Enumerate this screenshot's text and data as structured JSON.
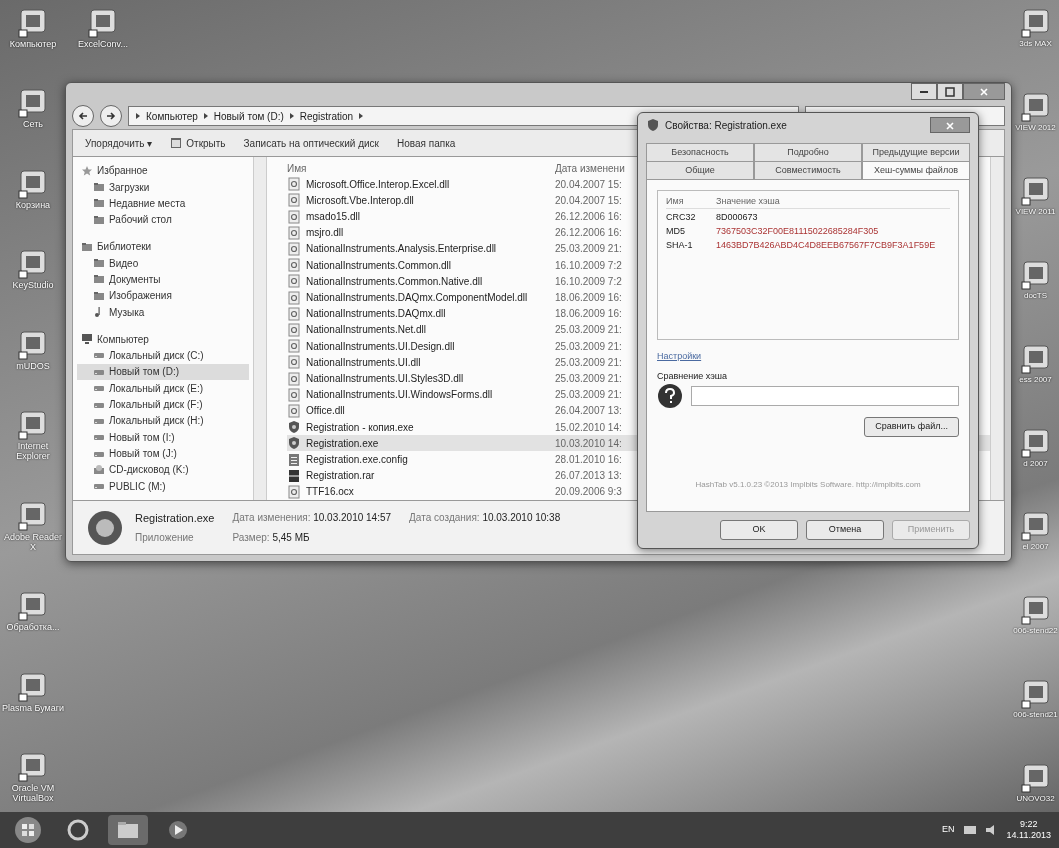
{
  "desktop_left": [
    {
      "label": "Компьютер"
    },
    {
      "label": "Сеть"
    },
    {
      "label": "Корзина"
    },
    {
      "label": "KeyStudio"
    },
    {
      "label": "mUDOS"
    },
    {
      "label": "Internet Explorer"
    },
    {
      "label": "Adobe Reader X"
    },
    {
      "label": "Обработка..."
    },
    {
      "label": "Plasma Бумаги"
    },
    {
      "label": "Oracle VM VirtualBox"
    }
  ],
  "desktop_top": [
    {
      "label": "ExcelConv..."
    }
  ],
  "desktop_right": [
    {
      "label": "3ds MAX"
    },
    {
      "label": "VIEW 2012"
    },
    {
      "label": "VIEW 2011"
    },
    {
      "label": "docTS"
    },
    {
      "label": "ess 2007"
    },
    {
      "label": "d 2007"
    },
    {
      "label": "el 2007"
    },
    {
      "label": "006-stend22"
    },
    {
      "label": "006-stend21"
    },
    {
      "label": "UNOVO32"
    }
  ],
  "explorer": {
    "breadcrumb": [
      "Компьютер",
      "Новый том (D:)",
      "Registration"
    ],
    "toolbar": [
      {
        "label": "Упорядочить ▾",
        "kind": "menu"
      },
      {
        "label": "Открыть",
        "kind": "open"
      },
      {
        "label": "Записать на оптический диск",
        "kind": "plain"
      },
      {
        "label": "Новая папка",
        "kind": "plain"
      }
    ],
    "nav": [
      {
        "label": "Избранное",
        "kind": "star",
        "children": [
          {
            "label": "Загрузки",
            "kind": "folder",
            "selected": false
          },
          {
            "label": "Недавние места",
            "kind": "folder",
            "selected": false
          },
          {
            "label": "Рабочий стол",
            "kind": "folder",
            "selected": false
          }
        ]
      },
      {
        "label": "Библиотеки",
        "kind": "folder",
        "children": [
          {
            "label": "Видео",
            "kind": "folder",
            "selected": false
          },
          {
            "label": "Документы",
            "kind": "folder",
            "selected": false
          },
          {
            "label": "Изображения",
            "kind": "folder",
            "selected": false
          },
          {
            "label": "Музыка",
            "kind": "music",
            "selected": false
          }
        ]
      },
      {
        "label": "Компьютер",
        "kind": "computer",
        "children": [
          {
            "label": "Локальный диск (C:)",
            "kind": "drive",
            "selected": false
          },
          {
            "label": "Новый том (D:)",
            "kind": "drive",
            "selected": true
          },
          {
            "label": "Локальный диск (E:)",
            "kind": "drive",
            "selected": false
          },
          {
            "label": "Локальный диск (F:)",
            "kind": "drive",
            "selected": false
          },
          {
            "label": "Локальный диск (H:)",
            "kind": "drive",
            "selected": false
          },
          {
            "label": "Новый том (I:)",
            "kind": "drive",
            "selected": false
          },
          {
            "label": "Новый том (J:)",
            "kind": "drive",
            "selected": false
          },
          {
            "label": "CD-дисковод (K:)",
            "kind": "cd",
            "selected": false
          },
          {
            "label": "PUBLIC (M:)",
            "kind": "drive",
            "selected": false
          }
        ]
      }
    ],
    "columns": [
      "Имя",
      "Дата изменени"
    ],
    "files": [
      {
        "name": "Microsoft.Office.Interop.Excel.dll",
        "date": "20.04.2007 15:",
        "kind": "dll",
        "selected": false
      },
      {
        "name": "Microsoft.Vbe.Interop.dll",
        "date": "20.04.2007 15:",
        "kind": "dll",
        "selected": false
      },
      {
        "name": "msado15.dll",
        "date": "26.12.2006 16:",
        "kind": "dll",
        "selected": false
      },
      {
        "name": "msjro.dll",
        "date": "26.12.2006 16:",
        "kind": "dll",
        "selected": false
      },
      {
        "name": "NationalInstruments.Analysis.Enterprise.dll",
        "date": "25.03.2009 21:",
        "kind": "dll",
        "selected": false
      },
      {
        "name": "NationalInstruments.Common.dll",
        "date": "16.10.2009 7:2",
        "kind": "dll",
        "selected": false
      },
      {
        "name": "NationalInstruments.Common.Native.dll",
        "date": "16.10.2009 7:2",
        "kind": "dll",
        "selected": false
      },
      {
        "name": "NationalInstruments.DAQmx.ComponentModel.dll",
        "date": "18.06.2009 16:",
        "kind": "dll",
        "selected": false
      },
      {
        "name": "NationalInstruments.DAQmx.dll",
        "date": "18.06.2009 16:",
        "kind": "dll",
        "selected": false
      },
      {
        "name": "NationalInstruments.Net.dll",
        "date": "25.03.2009 21:",
        "kind": "dll",
        "selected": false
      },
      {
        "name": "NationalInstruments.UI.Design.dll",
        "date": "25.03.2009 21:",
        "kind": "dll",
        "selected": false
      },
      {
        "name": "NationalInstruments.UI.dll",
        "date": "25.03.2009 21:",
        "kind": "dll",
        "selected": false
      },
      {
        "name": "NationalInstruments.UI.Styles3D.dll",
        "date": "25.03.2009 21:",
        "kind": "dll",
        "selected": false
      },
      {
        "name": "NationalInstruments.UI.WindowsForms.dll",
        "date": "25.03.2009 21:",
        "kind": "dll",
        "selected": false
      },
      {
        "name": "Office.dll",
        "date": "26.04.2007 13:",
        "kind": "dll",
        "selected": false
      },
      {
        "name": "Registration - копия.exe",
        "date": "15.02.2010 14:",
        "kind": "exe",
        "selected": false
      },
      {
        "name": "Registration.exe",
        "date": "10.03.2010 14:",
        "kind": "exe",
        "selected": true
      },
      {
        "name": "Registration.exe.config",
        "date": "28.01.2010 16:",
        "kind": "config",
        "selected": false
      },
      {
        "name": "Registration.rar",
        "date": "26.07.2013 13:",
        "kind": "rar",
        "selected": false
      },
      {
        "name": "TTF16.ocx",
        "date": "20.09.2006 9:3",
        "kind": "dll",
        "selected": false
      }
    ],
    "details": {
      "name": "Registration.exe",
      "type": "Приложение",
      "modified_label": "Дата изменения:",
      "modified": "10.03.2010 14:57",
      "size_label": "Размер:",
      "size": "5,45 МБ",
      "created_label": "Дата создания:",
      "created": "10.03.2010 10:38"
    }
  },
  "dialog": {
    "title": "Свойства: Registration.exe",
    "tab_rows": [
      [
        {
          "label": "Безопасность",
          "selected": false
        },
        {
          "label": "Подробно",
          "selected": false
        },
        {
          "label": "Предыдущие версии",
          "selected": false
        }
      ],
      [
        {
          "label": "Общие",
          "selected": false
        },
        {
          "label": "Совместимость",
          "selected": false
        },
        {
          "label": "Хеш-суммы файлов",
          "selected": true
        }
      ]
    ],
    "hash_columns": [
      "Имя",
      "Значение хэша"
    ],
    "hashes": [
      {
        "name": "CRC32",
        "value": "8D000673"
      },
      {
        "name": "MD5",
        "value": "7367503C32F00E81115022685284F305"
      },
      {
        "name": "SHA-1",
        "value": "1463BD7B426ABD4C4D8EEB67567F7CB9F3A1F59E"
      }
    ],
    "settings_link": "Настройки",
    "compare_label": "Сравнение хэша",
    "compare_button": "Сравнить файл...",
    "footer": "HashTab v5.1.0.23 ©2013 Implbits Software. http://implbits.com",
    "buttons": [
      {
        "label": "OK",
        "disabled": false
      },
      {
        "label": "Отмена",
        "disabled": false
      },
      {
        "label": "Применить",
        "disabled": true
      }
    ]
  },
  "taskbar": {
    "language": "EN",
    "time": "9:22",
    "date": "14.11.2013"
  }
}
